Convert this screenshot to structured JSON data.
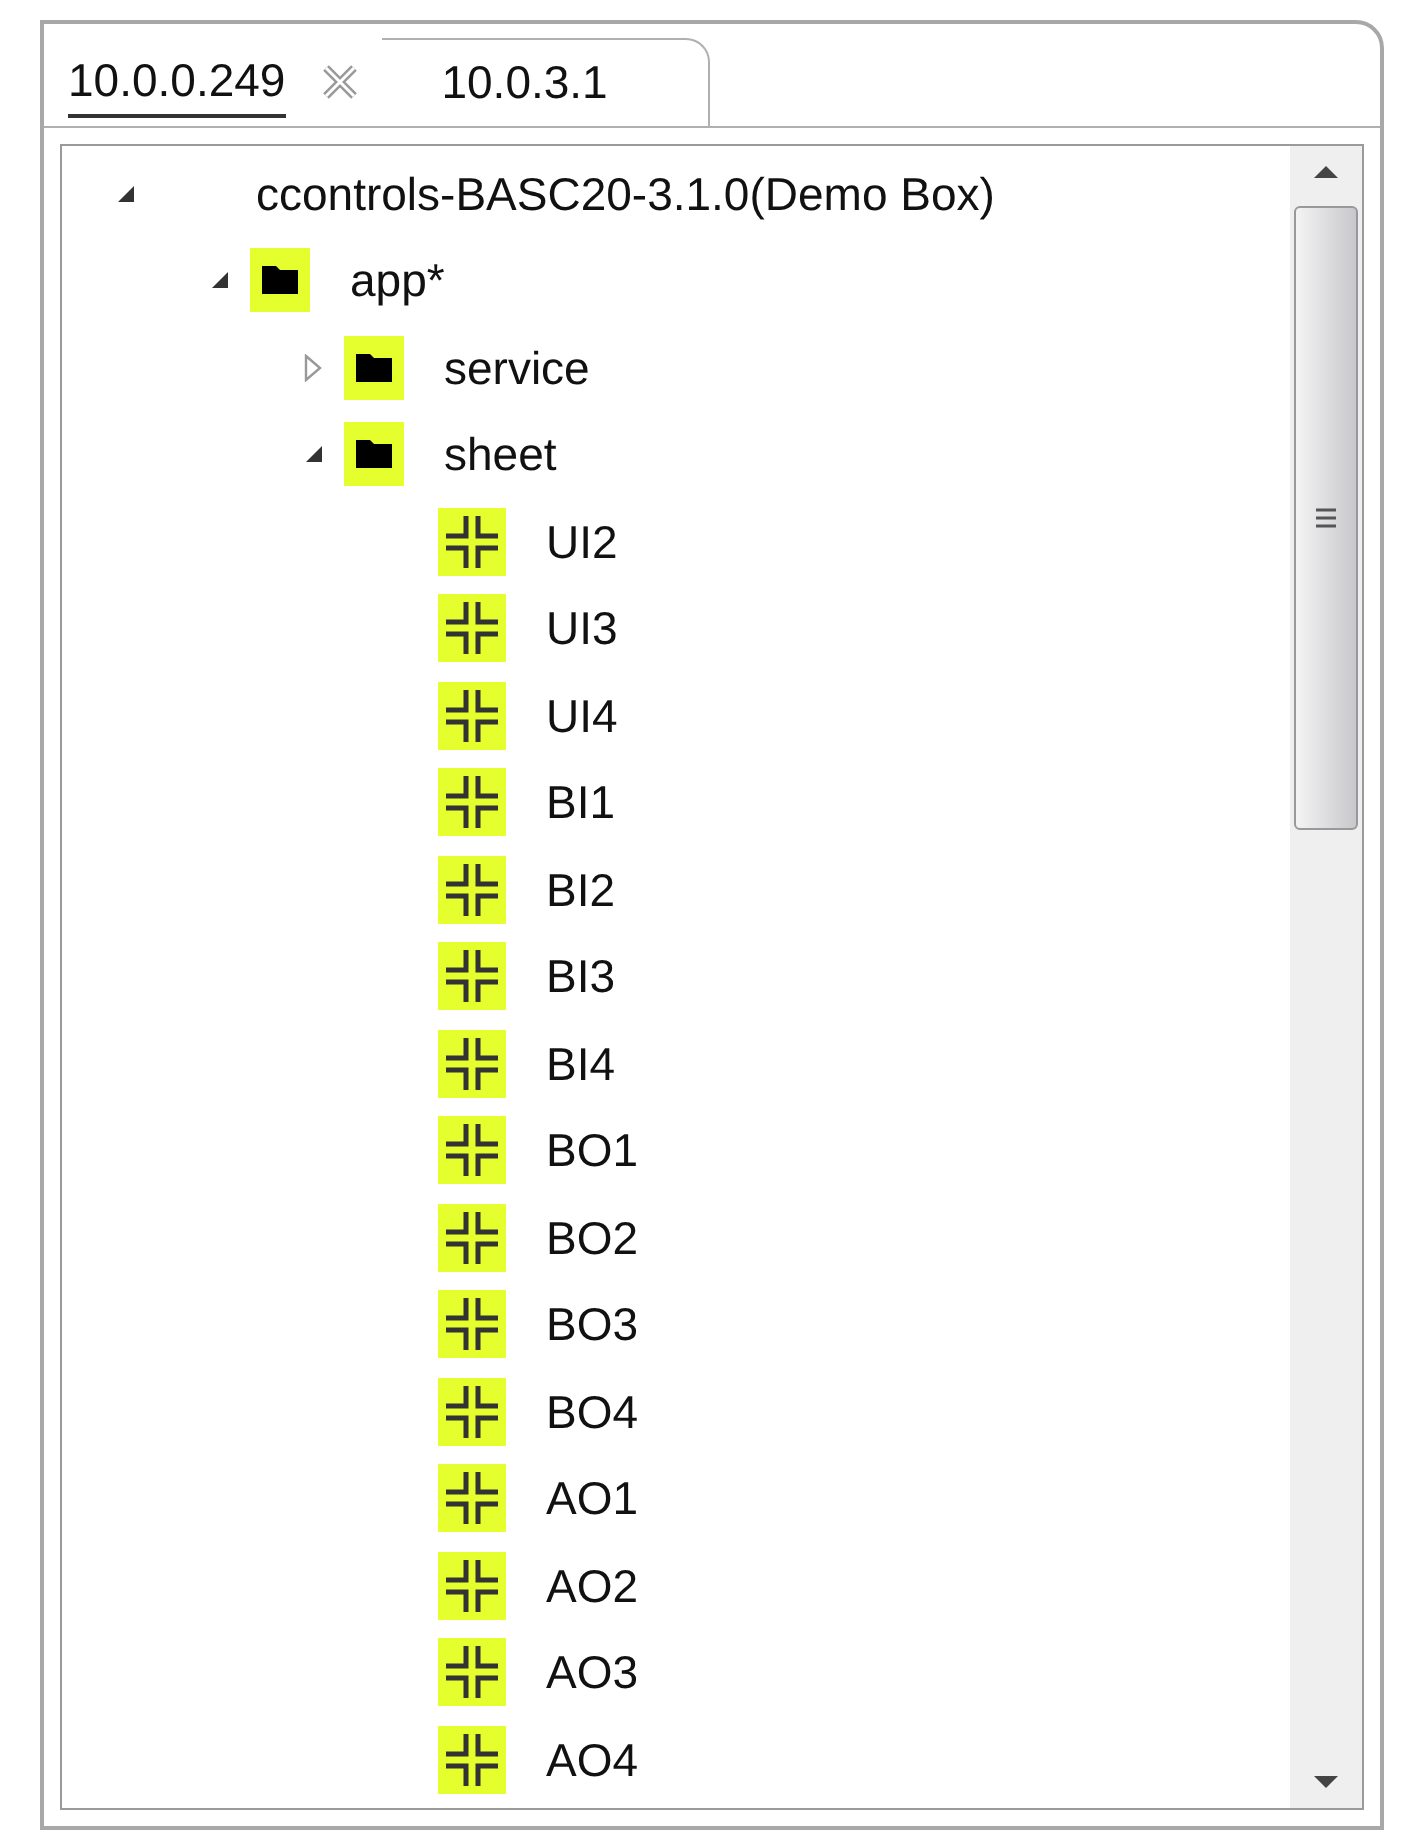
{
  "tabs": [
    {
      "label": "10.0.0.249",
      "selected": true,
      "closable": true
    },
    {
      "label": "10.0.3.1",
      "selected": false,
      "closable": false
    }
  ],
  "tree": [
    {
      "label": "ccontrols-BASC20-3.1.0(Demo Box)",
      "kind": "root",
      "expanded": true,
      "children": [
        {
          "label": "app*",
          "kind": "folder",
          "expanded": true,
          "children": [
            {
              "label": "service",
              "kind": "folder",
              "expanded": false
            },
            {
              "label": "sheet",
              "kind": "folder",
              "expanded": true,
              "children": [
                {
                  "label": "UI2",
                  "kind": "point"
                },
                {
                  "label": "UI3",
                  "kind": "point"
                },
                {
                  "label": "UI4",
                  "kind": "point"
                },
                {
                  "label": "BI1",
                  "kind": "point"
                },
                {
                  "label": "BI2",
                  "kind": "point"
                },
                {
                  "label": "BI3",
                  "kind": "point"
                },
                {
                  "label": "BI4",
                  "kind": "point"
                },
                {
                  "label": "BO1",
                  "kind": "point"
                },
                {
                  "label": "BO2",
                  "kind": "point"
                },
                {
                  "label": "BO3",
                  "kind": "point"
                },
                {
                  "label": "BO4",
                  "kind": "point"
                },
                {
                  "label": "AO1",
                  "kind": "point"
                },
                {
                  "label": "AO2",
                  "kind": "point"
                },
                {
                  "label": "AO3",
                  "kind": "point"
                },
                {
                  "label": "AO4",
                  "kind": "point"
                }
              ]
            }
          ]
        }
      ]
    }
  ]
}
